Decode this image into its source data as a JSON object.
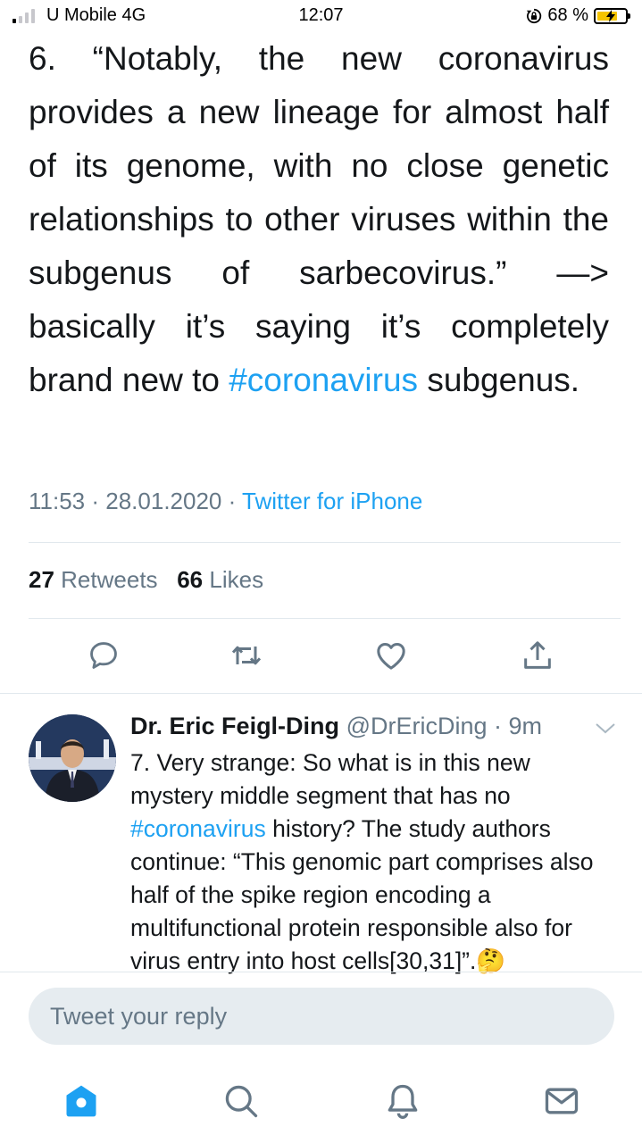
{
  "status_bar": {
    "carrier": "U Mobile 4G",
    "time": "12:07",
    "battery": "68 %",
    "signal_bars_active": 1,
    "signal_bars_total": 4
  },
  "tweet": {
    "text_main": "6. “Notably, the new coronavirus provides a new lineage for almost half of its genome, with no close genetic relationships to other viruses within the subgenus of sarbecovirus.” —> basically it’s saying it’s completely brand new to",
    "hashtag": "#coronavirus",
    "text_tail": " subgenus.",
    "time": "11:53",
    "date": "28.01.2020",
    "separator": " · ",
    "client": "Twitter for iPhone",
    "retweets_count": "27",
    "retweets_label": "Retweets",
    "likes_count": "66",
    "likes_label": "Likes"
  },
  "actions": {
    "icons": [
      "reply-icon",
      "retweet-icon",
      "like-icon",
      "share-icon"
    ]
  },
  "reply": {
    "name": "Dr. Eric Feigl-Ding",
    "handle": "@DrEricDing",
    "separator": " · ",
    "age": "9m",
    "text_a": "7. Very strange: So what is in this new mystery middle segment that has no ",
    "hashtag": "#coronavirus",
    "text_b": " history? The study authors continue: “This genomic part comprises also half of the spike region encoding a multifunctional protein responsible also for virus entry into host cells[30,31]”.",
    "emoji": "🤔"
  },
  "compose": {
    "placeholder": "Tweet your reply"
  },
  "tab_bar": {
    "icons": [
      "home-icon",
      "search-icon",
      "notifications-icon",
      "messages-icon"
    ],
    "active": "home-icon"
  },
  "colors": {
    "accent": "#1da1f2",
    "text": "#14171a",
    "secondary": "#657786",
    "divider": "#e1e8ed",
    "input_bg": "#e6ecf0",
    "battery": "#f5c400"
  }
}
